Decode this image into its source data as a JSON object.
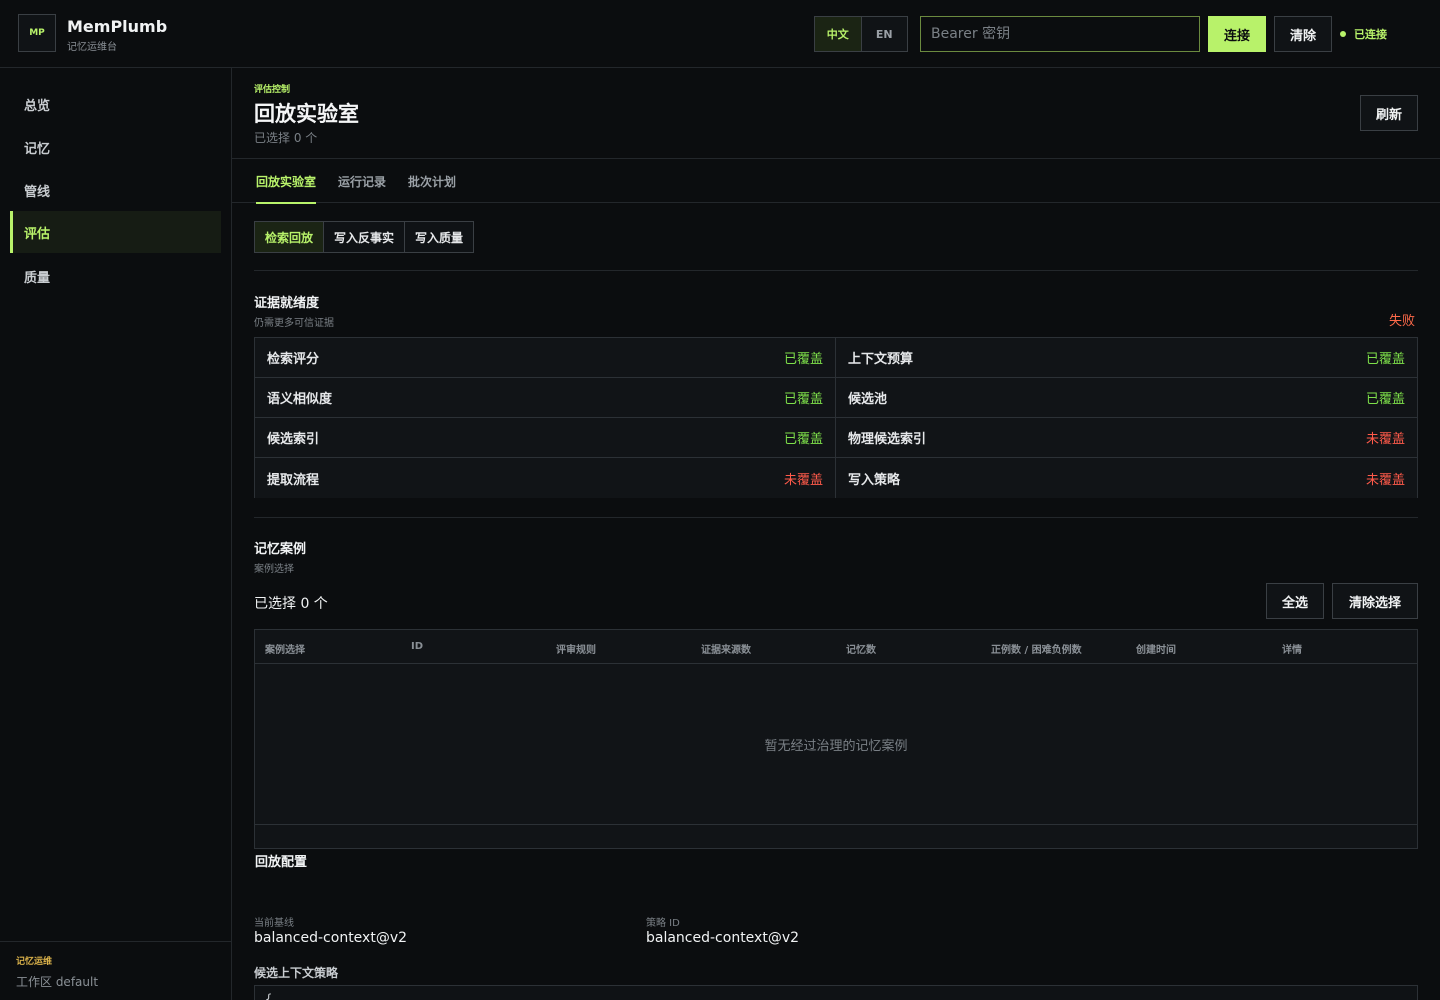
{
  "header": {
    "logo": "MP",
    "brand_name": "MemPlumb",
    "brand_sub": "记忆运维台",
    "lang": {
      "zh": "中文",
      "en": "EN"
    },
    "token_placeholder": "Bearer 密钥",
    "connect": "连接",
    "clear": "清除",
    "status": "已连接"
  },
  "sidebar": {
    "items": [
      {
        "label": "总览"
      },
      {
        "label": "记忆"
      },
      {
        "label": "管线"
      },
      {
        "label": "评估"
      },
      {
        "label": "质量"
      }
    ],
    "footer_title": "记忆运维",
    "workspace": "工作区 default"
  },
  "page": {
    "eyebrow": "评估控制",
    "title": "回放实验室",
    "subtitle": "已选择 0 个",
    "refresh": "刷新"
  },
  "tabs": [
    {
      "label": "回放实验室"
    },
    {
      "label": "运行记录"
    },
    {
      "label": "批次计划"
    }
  ],
  "segments": [
    {
      "label": "检索回放"
    },
    {
      "label": "写入反事实"
    },
    {
      "label": "写入质量"
    }
  ],
  "readiness": {
    "title": "证据就绪度",
    "subtitle": "仍需更多可信证据",
    "status": "失败",
    "cells": [
      {
        "name": "检索评分",
        "value": "已覆盖"
      },
      {
        "name": "上下文预算",
        "value": "已覆盖"
      },
      {
        "name": "语义相似度",
        "value": "已覆盖"
      },
      {
        "name": "候选池",
        "value": "已覆盖"
      },
      {
        "name": "候选索引",
        "value": "已覆盖"
      },
      {
        "name": "物理候选索引",
        "value": "未覆盖"
      },
      {
        "name": "提取流程",
        "value": "未覆盖"
      },
      {
        "name": "写入策略",
        "value": "未覆盖"
      }
    ]
  },
  "cases": {
    "title": "记忆案例",
    "subtitle": "案例选择",
    "selected": "已选择 0 个",
    "select_all": "全选",
    "clear_selection": "清除选择",
    "columns": [
      "案例选择",
      "ID",
      "评审规则",
      "证据来源数",
      "记忆数",
      "正例数 / 困难负例数",
      "创建时间",
      "详情"
    ],
    "empty": "暂无经过治理的记忆案例"
  },
  "replay_config": {
    "title": "回放配置",
    "baseline_label": "当前基线",
    "baseline_value": "balanced-context@v2",
    "policy_label": "策略 ID",
    "policy_value": "balanced-context@v2",
    "candidate_title": "候选上下文策略",
    "code": "{"
  },
  "colors": {
    "accent": "#b8f26a",
    "ok": "#7ee04a",
    "bad": "#ff5a4a",
    "warn": "#d8b04a"
  }
}
